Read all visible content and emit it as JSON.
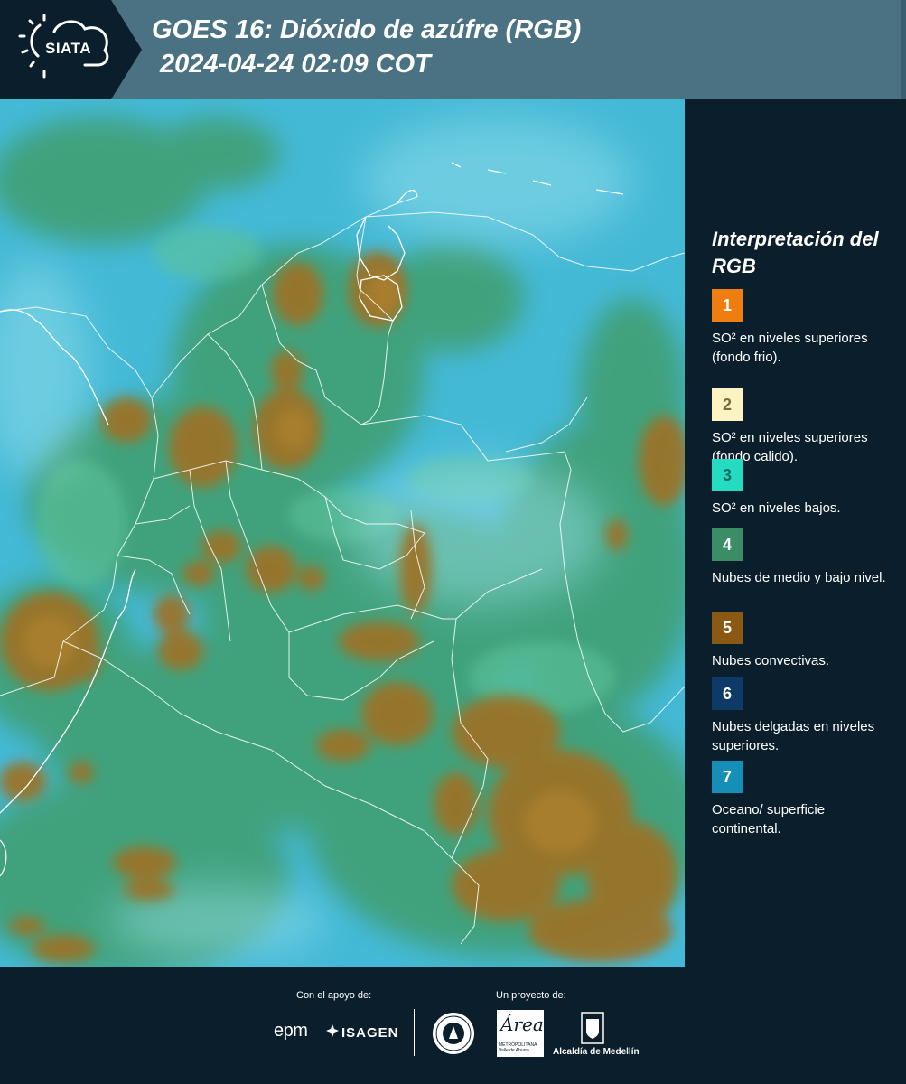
{
  "header": {
    "logo": "SIATA",
    "title_line1": "GOES 16: Dióxido de azúfre (RGB)",
    "title_line2": "2024-04-24 02:09 COT"
  },
  "map": {
    "region": "Colombia",
    "product": "GOES 16 SO2 RGB",
    "background_color": "#44b9d6"
  },
  "legend": {
    "title": "Interpretación del RGB",
    "items": [
      {
        "number": "1",
        "color": "#f07d0f",
        "number_color": "#ffffff",
        "text": "SO² en niveles superiores (fondo frio)."
      },
      {
        "number": "2",
        "color": "#fbf3c1",
        "number_color": "#7a6b3a",
        "text": "SO² en niveles superiores (fondo calido)."
      },
      {
        "number": "3",
        "color": "#23dcc1",
        "number_color": "#0f6d60",
        "text": "SO² en niveles bajos."
      },
      {
        "number": "4",
        "color": "#3a8d64",
        "number_color": "#ffffff",
        "text": "Nubes de medio y bajo nivel."
      },
      {
        "number": "5",
        "color": "#8a5a15",
        "number_color": "#ffffff",
        "text": "Nubes convectivas."
      },
      {
        "number": "6",
        "color": "#0e3a68",
        "number_color": "#ffffff",
        "text": "Nubes delgadas en niveles superiores."
      },
      {
        "number": "7",
        "color": "#168fb8",
        "number_color": "#ffffff",
        "text": "Oceano/ superficie continental."
      }
    ]
  },
  "footer": {
    "support_label": "Con el apoyo de:",
    "project_label": "Un proyecto de:",
    "sponsor_1": "epm",
    "sponsor_2": "ISAGEN",
    "area_logo_text": "Área",
    "area_caption": "METROPOLITANA Valle de Aburrá",
    "alcaldia": "Alcaldía de Medellín"
  }
}
